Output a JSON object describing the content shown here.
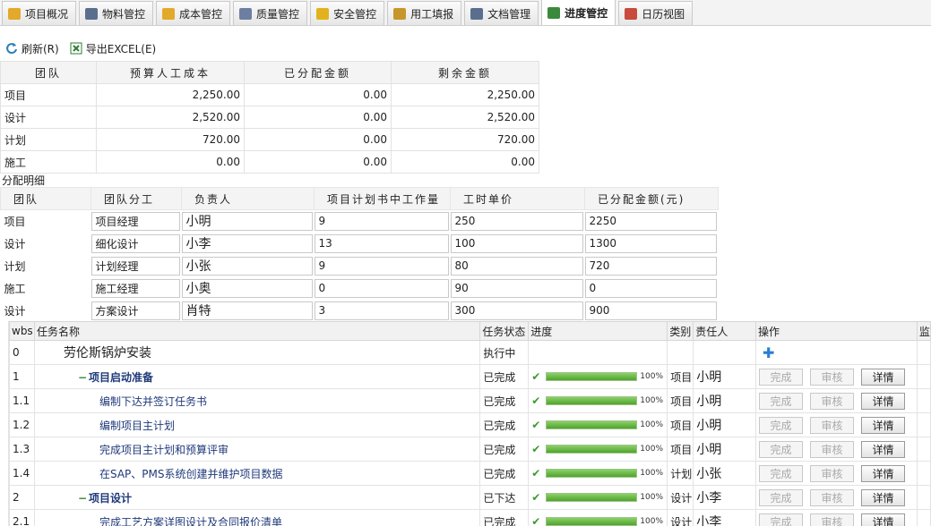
{
  "tabs": [
    {
      "label": "项目概况",
      "icon": "folder-icon",
      "color": "#e3a92a"
    },
    {
      "label": "物料管控",
      "icon": "truck-icon",
      "color": "#5a6f8e"
    },
    {
      "label": "成本管控",
      "icon": "folder-icon",
      "color": "#e3a92a"
    },
    {
      "label": "质量管控",
      "icon": "wrench-icon",
      "color": "#6d7fa0"
    },
    {
      "label": "安全管控",
      "icon": "warning-icon",
      "color": "#e2b21c"
    },
    {
      "label": "用工填报",
      "icon": "pencil-icon",
      "color": "#c7962a"
    },
    {
      "label": "文档管理",
      "icon": "truck-icon",
      "color": "#5a6f8e"
    },
    {
      "label": "进度管控",
      "icon": "table-icon",
      "color": "#3b8a3b"
    },
    {
      "label": "日历视图",
      "icon": "calendar-icon",
      "color": "#c84b3c"
    }
  ],
  "active_tab": "进度管控",
  "toolbar": {
    "refresh": "刷新(R)",
    "export": "导出EXCEL(E)"
  },
  "summary": {
    "headers": [
      "团队",
      "预算人工成本",
      "已分配金额",
      "剩余金额"
    ],
    "rows": [
      [
        "项目",
        "2,250.00",
        "0.00",
        "2,250.00"
      ],
      [
        "设计",
        "2,520.00",
        "0.00",
        "2,520.00"
      ],
      [
        "计划",
        "720.00",
        "0.00",
        "720.00"
      ],
      [
        "施工",
        "0.00",
        "0.00",
        "0.00"
      ]
    ]
  },
  "alloc_label": "分配明细",
  "alloc": {
    "headers": [
      "团队",
      "团队分工",
      "负责人",
      "项目计划书中工作量",
      "工时单价",
      "已分配金额(元)"
    ],
    "rows": [
      [
        "项目",
        "项目经理",
        "小明",
        "9",
        "250",
        "2250"
      ],
      [
        "设计",
        "细化设计",
        "小李",
        "13",
        "100",
        "1300"
      ],
      [
        "计划",
        "计划经理",
        "小张",
        "9",
        "80",
        "720"
      ],
      [
        "施工",
        "施工经理",
        "小奥",
        "0",
        "90",
        "0"
      ],
      [
        "设计",
        "方案设计",
        "肖特",
        "3",
        "300",
        "900"
      ]
    ]
  },
  "grid": {
    "headers": [
      "wbs",
      "任务名称",
      "任务状态",
      "进度",
      "类别",
      "责任人",
      "操作",
      "监"
    ],
    "op_buttons": [
      "完成",
      "审核",
      "详情"
    ],
    "rows": [
      {
        "wbs": "0",
        "name": "劳伦斯锅炉安装",
        "level": 0,
        "status": "执行中",
        "progress": null,
        "category": "",
        "owner": "",
        "ops": "add"
      },
      {
        "wbs": "1",
        "name": "项目启动准备",
        "level": 1,
        "status": "已完成",
        "progress": 100,
        "pct": "100%",
        "category": "项目",
        "owner": "小明",
        "ops": "buttons"
      },
      {
        "wbs": "1.1",
        "name": "编制下达并签订任务书",
        "level": 2,
        "status": "已完成",
        "progress": 100,
        "pct": "100%",
        "category": "项目",
        "owner": "小明",
        "ops": "buttons"
      },
      {
        "wbs": "1.2",
        "name": "编制项目主计划",
        "level": 2,
        "status": "已完成",
        "progress": 100,
        "pct": "100%",
        "category": "项目",
        "owner": "小明",
        "ops": "buttons"
      },
      {
        "wbs": "1.3",
        "name": "完成项目主计划和预算评审",
        "level": 2,
        "status": "已完成",
        "progress": 100,
        "pct": "100%",
        "category": "项目",
        "owner": "小明",
        "ops": "buttons"
      },
      {
        "wbs": "1.4",
        "name": "在SAP、PMS系统创建并维护项目数据",
        "level": 2,
        "status": "已完成",
        "progress": 100,
        "pct": "100%",
        "category": "计划",
        "owner": "小张",
        "ops": "buttons"
      },
      {
        "wbs": "2",
        "name": "项目设计",
        "level": 1,
        "status": "已下达",
        "progress": 100,
        "pct": "100%",
        "category": "设计",
        "owner": "小李",
        "ops": "buttons"
      },
      {
        "wbs": "2.1",
        "name": "完成工艺方案详图设计及合同报价清单",
        "level": 2,
        "status": "已完成",
        "progress": 100,
        "pct": "100%",
        "category": "设计",
        "owner": "小李",
        "ops": "buttons"
      }
    ]
  }
}
